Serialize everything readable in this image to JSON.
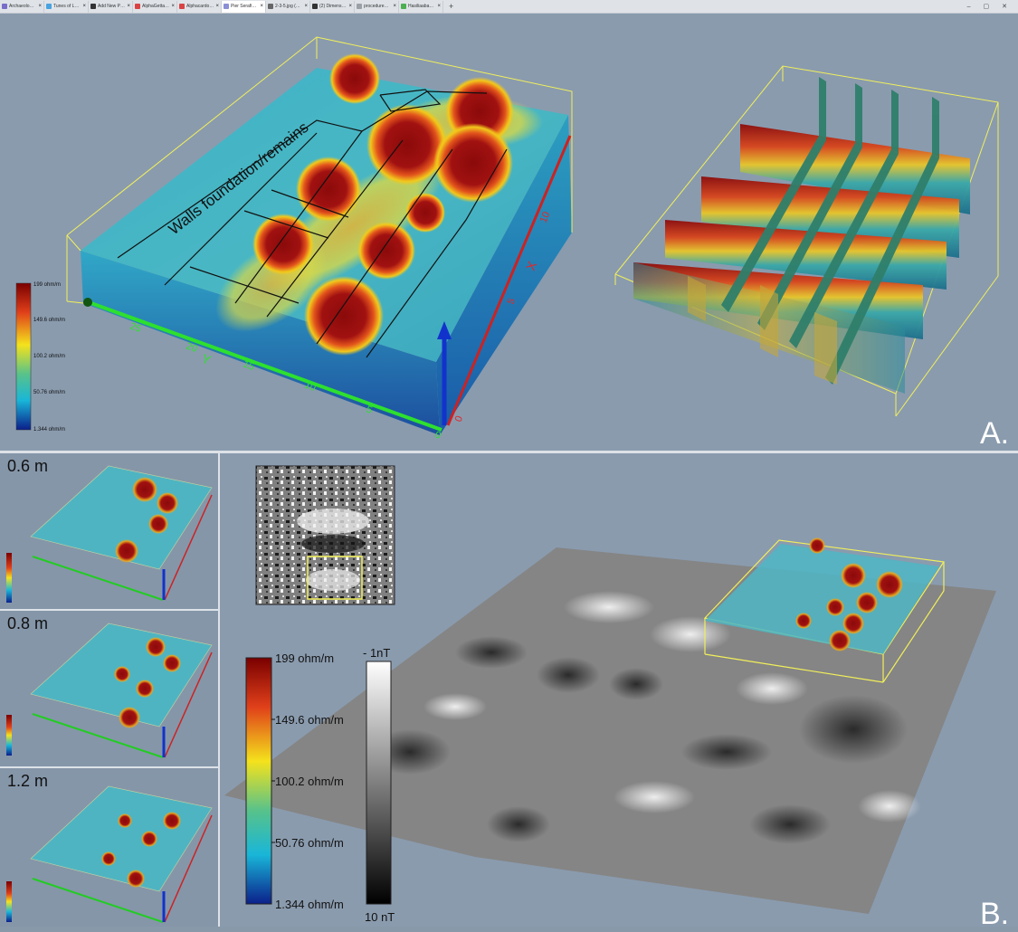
{
  "browser": {
    "tabs": [
      {
        "label": "Archaeolo…",
        "color": "#7a6cc9",
        "active": false
      },
      {
        "label": "Tunes of Lov…",
        "color": "#4aa3df",
        "active": false
      },
      {
        "label": "Add New P…",
        "color": "#333333",
        "active": false
      },
      {
        "label": "AlphaGetta…",
        "color": "#d94343",
        "active": false
      },
      {
        "label": "Alphacardo…",
        "color": "#d94343",
        "active": false
      },
      {
        "label": "Pier Serafini…",
        "color": "#8a8fd6",
        "active": true
      },
      {
        "label": "2-3-5.jpg (…",
        "color": "#666666",
        "active": false
      },
      {
        "label": "(2) Dimensio…",
        "color": "#333333",
        "active": false
      },
      {
        "label": "procedure…",
        "color": "#9aa0a6",
        "active": false
      },
      {
        "label": "Hasiliaaba…",
        "color": "#4caf50",
        "active": false
      }
    ],
    "new_tab": "+",
    "window_controls": [
      "–",
      "▢",
      "✕"
    ]
  },
  "panelA": {
    "letter": "A.",
    "annotation": "Walls foundation/remains",
    "colorbar_small": {
      "max": "199 ohm/m",
      "t2": "149.6 ohm/m",
      "mid": "100.2 ohm/m",
      "t4": "50.76 ohm/m",
      "min": "1.344 ohm/m"
    },
    "x_axis": {
      "name": "X",
      "ticks": [
        "0",
        "5",
        "10"
      ]
    },
    "y_axis": {
      "name": "Y",
      "ticks": [
        "0",
        "5",
        "10",
        "15",
        "20",
        "25"
      ]
    }
  },
  "panelB": {
    "letter": "B.",
    "depth_slices": [
      "0.6 m",
      "0.8 m",
      "1.2 m"
    ],
    "resistivity_colorbar": [
      "199 ohm/m",
      "149.6 ohm/m",
      "100.2 ohm/m",
      "50.76 ohm/m",
      "1.344 ohm/m"
    ],
    "magnetic_colorbar": {
      "top": "- 1nT",
      "bottom": "10 nT"
    }
  },
  "colors": {
    "high": "#8b0a0a",
    "mid": "#f2c81b",
    "low": "#37a9c4",
    "box_outline": "#f1ef5a",
    "x_axis": "#cc2222",
    "y_axis": "#22cc22",
    "z_axis": "#1133cc"
  }
}
